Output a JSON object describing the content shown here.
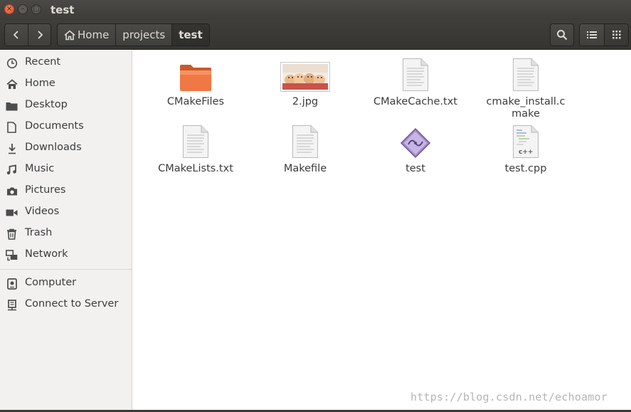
{
  "window": {
    "title": "test",
    "controls": {
      "close": "×",
      "minimize": "–",
      "maximize": "□"
    }
  },
  "toolbar": {
    "back_icon": "chevron-left-icon",
    "forward_icon": "chevron-right-icon",
    "breadcrumbs": [
      {
        "label": "Home",
        "icon": "home-icon"
      },
      {
        "label": "projects"
      },
      {
        "label": "test",
        "current": true
      }
    ],
    "search_icon": "search-icon",
    "view_list_icon": "list-view-icon",
    "view_grid_icon": "grid-view-icon"
  },
  "sidebar": {
    "items": [
      {
        "label": "Recent",
        "icon": "clock-icon"
      },
      {
        "label": "Home",
        "icon": "home-icon"
      },
      {
        "label": "Desktop",
        "icon": "folder-icon"
      },
      {
        "label": "Documents",
        "icon": "document-icon"
      },
      {
        "label": "Downloads",
        "icon": "download-icon"
      },
      {
        "label": "Music",
        "icon": "music-icon"
      },
      {
        "label": "Pictures",
        "icon": "camera-icon"
      },
      {
        "label": "Videos",
        "icon": "video-icon"
      },
      {
        "label": "Trash",
        "icon": "trash-icon"
      },
      {
        "label": "Network",
        "icon": "network-icon"
      },
      {
        "label": "Computer",
        "icon": "drive-icon"
      },
      {
        "label": "Connect to Server",
        "icon": "server-icon"
      }
    ]
  },
  "files": [
    {
      "name": "CMakeFiles",
      "type": "folder"
    },
    {
      "name": "2.jpg",
      "type": "image"
    },
    {
      "name": "CMakeCache.txt",
      "type": "text"
    },
    {
      "name": "cmake_install.cmake",
      "type": "text"
    },
    {
      "name": "CMakeLists.txt",
      "type": "text"
    },
    {
      "name": "Makefile",
      "type": "text"
    },
    {
      "name": "test",
      "type": "executable"
    },
    {
      "name": "test.cpp",
      "type": "cpp",
      "badge": "c++"
    }
  ],
  "watermark": "https://blog.csdn.net/echoamor",
  "colors": {
    "titlebar": "#3d3c38",
    "close_button": "#e0542c",
    "folder_orange": "#f07040",
    "sidebar_bg": "#f2f1f0",
    "executable_purple": "#8a6fb0"
  }
}
